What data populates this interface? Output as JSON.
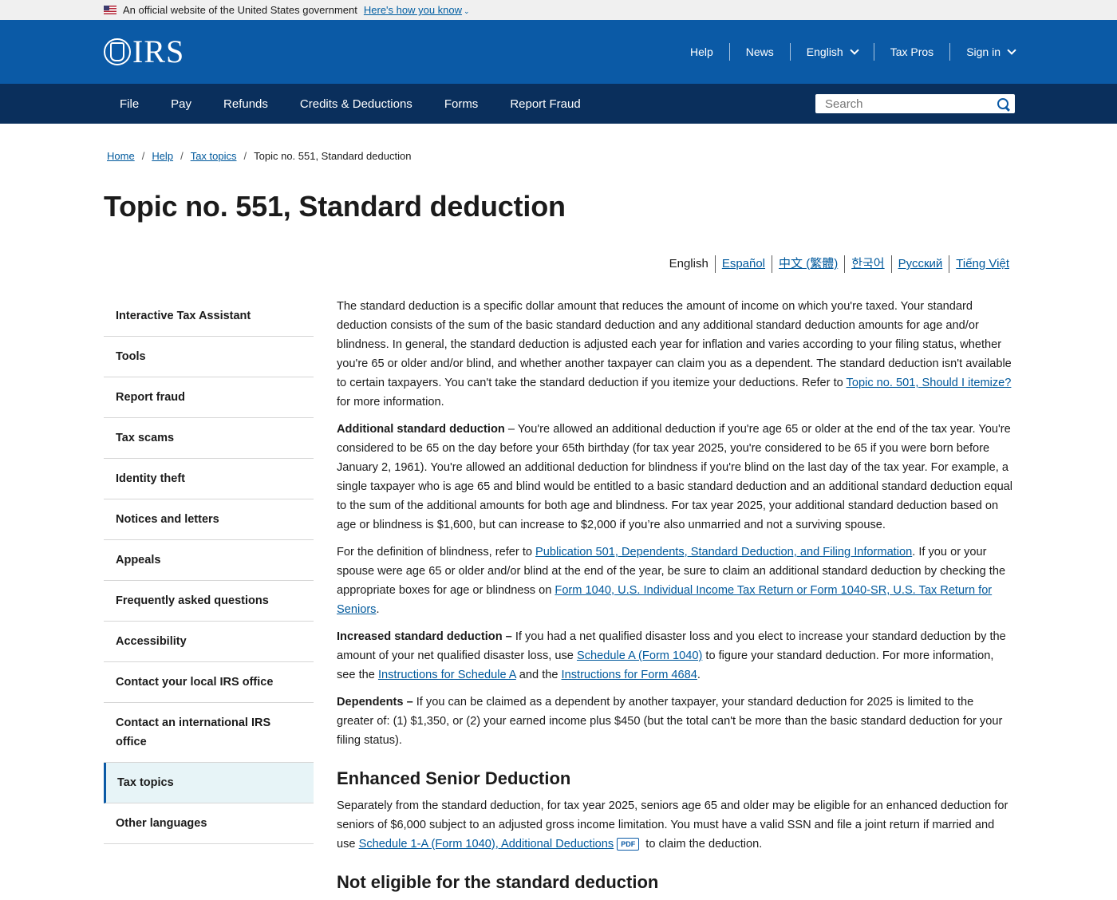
{
  "gov_banner": {
    "text": "An official website of the United States government",
    "link": "Here's how you know"
  },
  "header": {
    "logo": "IRS",
    "utility_nav": [
      "Help",
      "News",
      "English",
      "Tax Pros",
      "Sign in"
    ]
  },
  "main_nav": {
    "items": [
      "File",
      "Pay",
      "Refunds",
      "Credits & Deductions",
      "Forms",
      "Report Fraud"
    ],
    "search_placeholder": "Search"
  },
  "breadcrumb": {
    "items": [
      "Home",
      "Help",
      "Tax topics"
    ],
    "separator": "/",
    "current": "Topic no. 551, Standard deduction"
  },
  "page_title": "Topic no. 551, Standard deduction",
  "languages": [
    "English",
    "Español",
    "中文 (繁體)",
    "한국어",
    "Русский",
    "Tiếng Việt"
  ],
  "sidebar": {
    "items": [
      "Interactive Tax Assistant",
      "Tools",
      "Report fraud",
      "Tax scams",
      "Identity theft",
      "Notices and letters",
      "Appeals",
      "Frequently asked questions",
      "Accessibility",
      "Contact your local IRS office",
      "Contact an international IRS office",
      "Tax topics",
      "Other languages"
    ],
    "active": "Tax topics"
  },
  "content": {
    "p1": {
      "text": "The standard deduction is a specific dollar amount that reduces the amount of income on which you're taxed. Your standard deduction consists of the sum of the basic standard deduction and any additional standard deduction amounts for age and/or blindness. In general, the standard deduction is adjusted each year for inflation and varies according to your filing status, whether you're 65 or older and/or blind, and whether another taxpayer can claim you as a dependent. The standard deduction isn't available to certain taxpayers. You can't take the standard deduction if you itemize your deductions. Refer to ",
      "link": "Topic no. 501, Should I itemize?",
      "after": " for more information."
    },
    "p2": {
      "bold": "Additional standard deduction",
      "text": " – You're allowed an additional deduction if you're age 65 or older at the end of the tax year. You're considered to be 65 on the day before your 65th birthday (for tax year 2025, you're considered to be 65 if you were born before January 2, 1961). You're allowed an additional deduction for blindness if you're blind on the last day of the tax year. For example, a single taxpayer who is age 65 and blind would be entitled to a basic standard deduction and an additional standard deduction equal to the sum of the additional amounts for both age and blindness. For tax year 2025, your additional standard deduction based on age or blindness is $1,600, but can increase to $2,000 if you’re also unmarried and not a surviving spouse."
    },
    "p3": {
      "text1": "For the definition of blindness, refer to ",
      "link1": "Publication 501, Dependents, Standard Deduction, and Filing Information",
      "text2": ". If you or your spouse were age 65 or older and/or blind at the end of the year, be sure to claim an additional standard deduction by checking the appropriate boxes for age or blindness on ",
      "link2": "Form 1040, U.S. Individual Income Tax Return or Form 1040-SR, U.S. Tax Return for Seniors",
      "text3": "."
    },
    "p4": {
      "bold": "Increased standard deduction –",
      "text1": " If you had a net qualified disaster loss and you elect to increase your standard deduction by the amount of your net qualified disaster loss, use ",
      "link1": "Schedule A (Form 1040)",
      "text2": " to figure your standard deduction. For more information, see the ",
      "link2": "Instructions for Schedule A",
      "text3": " and the ",
      "link3": "Instructions for Form 4684",
      "text4": "."
    },
    "p5": {
      "bold": "Dependents –",
      "text": " If you can be claimed as a dependent by another taxpayer, your standard deduction for 2025 is limited to the greater of: (1) $1,350, or (2) your earned income plus $450 (but the total can't be more than the basic standard deduction for your filing status)."
    },
    "h2_enhanced": "Enhanced Senior Deduction",
    "p6": {
      "text1": "Separately from the standard deduction, for tax year 2025, seniors age 65 and older may be eligible for an enhanced deduction for seniors of $6,000 subject to an adjusted gross income limitation. You must have a valid SSN and file a joint return if married and use ",
      "link": "Schedule 1-A (Form 1040), Additional Deductions",
      "badge": "PDF",
      "text2": " to claim the deduction."
    },
    "h2_not_eligible": "Not eligible for the standard deduction"
  }
}
